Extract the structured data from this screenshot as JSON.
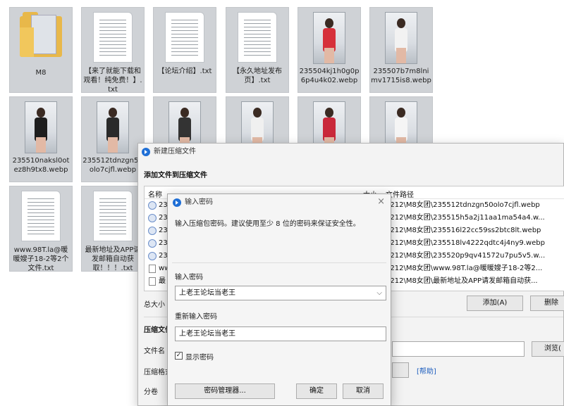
{
  "files": {
    "row1": [
      {
        "name": "M8",
        "kind": "folder"
      },
      {
        "name": "【来了就能下载和观看！纯免费！】.txt",
        "kind": "text"
      },
      {
        "name": "【论坛介绍】.txt",
        "kind": "text"
      },
      {
        "name": "【永久地址发布页】.txt",
        "kind": "text"
      },
      {
        "name": "235504kj1h0g0p6p4u4k02.webp",
        "kind": "image"
      },
      {
        "name": "235507b7m8lnimv1715is8.webp",
        "kind": "image"
      }
    ],
    "row2": [
      {
        "name": "235510naksl0otez8h9tx8.webp",
        "kind": "image"
      },
      {
        "name": "235512tdnzgn50olo7cjfl.webp",
        "kind": "image"
      }
    ],
    "row3": [
      {
        "name": "www.98T.la@暖暖嫂子18-2等2个文件.txt",
        "kind": "text"
      },
      {
        "name": "最新地址及APP请发邮箱自动获取！！！.txt",
        "kind": "text"
      }
    ]
  },
  "compress_dialog": {
    "title": "新建压缩文件",
    "heading": "添加文件到压缩文件",
    "col_name": "名称",
    "col_size": "大小",
    "col_path": "文件路径",
    "rows": [
      {
        "name": "235",
        "path": "1212\\M8女团\\235512tdnzgn50olo7cjfl.webp"
      },
      {
        "name": "235",
        "path": "1212\\M8女团\\235515h5a2j11aa1ma54a4.w..."
      },
      {
        "name": "235",
        "path": "1212\\M8女团\\235516l22cc59ss2btc8lt.webp"
      },
      {
        "name": "235",
        "path": "1212\\M8女团\\235518lv4222qdtc4j4ny9.webp"
      },
      {
        "name": "235",
        "path": "1212\\M8女团\\235520p9qv41572u7pu5v5.w..."
      },
      {
        "name": "ww",
        "path": "1212\\M8女团\\www.98T.la@暖暖嫂子18-2等2..."
      },
      {
        "name": "最",
        "path": "1212\\M8女团\\最新地址及APP请发邮箱自动获..."
      }
    ],
    "total_label": "总大小",
    "add_button": "添加(A)",
    "delete_button": "删除",
    "section_label": "压缩文件",
    "filename_label": "文件名",
    "browse_button": "浏览(",
    "format_label": "压缩格式",
    "help_link": "[帮助]",
    "split_label": "分卷"
  },
  "password_dialog": {
    "title": "输入密码",
    "close_glyph": "×",
    "note": "输入压缩包密码。建议使用至少 8 位的密码来保证安全性。",
    "password_label": "输入密码",
    "password_value": "上老王论坛当老王",
    "confirm_label": "重新输入密码",
    "confirm_value": "上老王论坛当老王",
    "show_password_label": "显示密码",
    "show_password_checked": "✓",
    "manager_button": "密码管理器...",
    "ok_button": "确定",
    "cancel_button": "取消"
  }
}
